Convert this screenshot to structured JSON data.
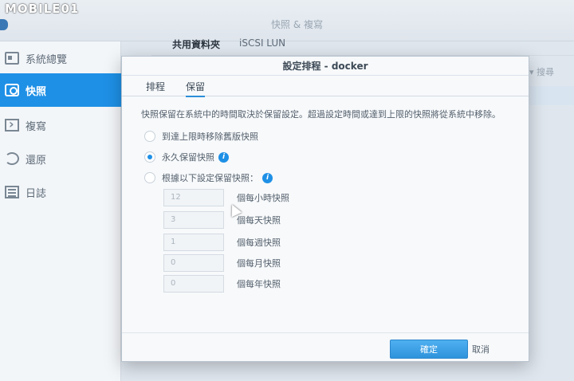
{
  "watermark": "MOBILE01",
  "app": {
    "title": "快照 & 複寫"
  },
  "sidebar": {
    "items": [
      {
        "label": "系統總覽",
        "icon": "overview-icon"
      },
      {
        "label": "快照",
        "icon": "camera-icon",
        "active": true
      },
      {
        "label": "複寫",
        "icon": "copy-icon"
      },
      {
        "label": "還原",
        "icon": "restore-icon"
      },
      {
        "label": "日誌",
        "icon": "log-icon"
      }
    ]
  },
  "top_tabs": [
    {
      "label": "共用資料夾",
      "active": true
    },
    {
      "label": "iSCSI LUN",
      "active": false
    }
  ],
  "search": {
    "label": "▾ 搜尋"
  },
  "dialog": {
    "title": "設定排程 - docker",
    "tabs": [
      {
        "label": "排程",
        "active": false
      },
      {
        "label": "保留",
        "active": true
      }
    ],
    "description": "快照保留在系統中的時間取決於保留設定。超過設定時間或達到上限的快照將從系統中移除。",
    "options": [
      {
        "label": "到達上限時移除舊版快照",
        "checked": false
      },
      {
        "label": "永久保留快照",
        "checked": true
      },
      {
        "label": "根據以下設定保留快照：",
        "checked": false
      }
    ],
    "retention": [
      {
        "value": "12",
        "label": "個每小時快照"
      },
      {
        "value": "3",
        "label": "個每天快照"
      },
      {
        "value": "1",
        "label": "個每週快照"
      },
      {
        "value": "0",
        "label": "個每月快照"
      },
      {
        "value": "0",
        "label": "個每年快照"
      }
    ],
    "ok_label": "確定",
    "cancel_label": "取消"
  },
  "colors": {
    "accent": "#1e90e6",
    "sidebar_active": "#1e90e6"
  }
}
